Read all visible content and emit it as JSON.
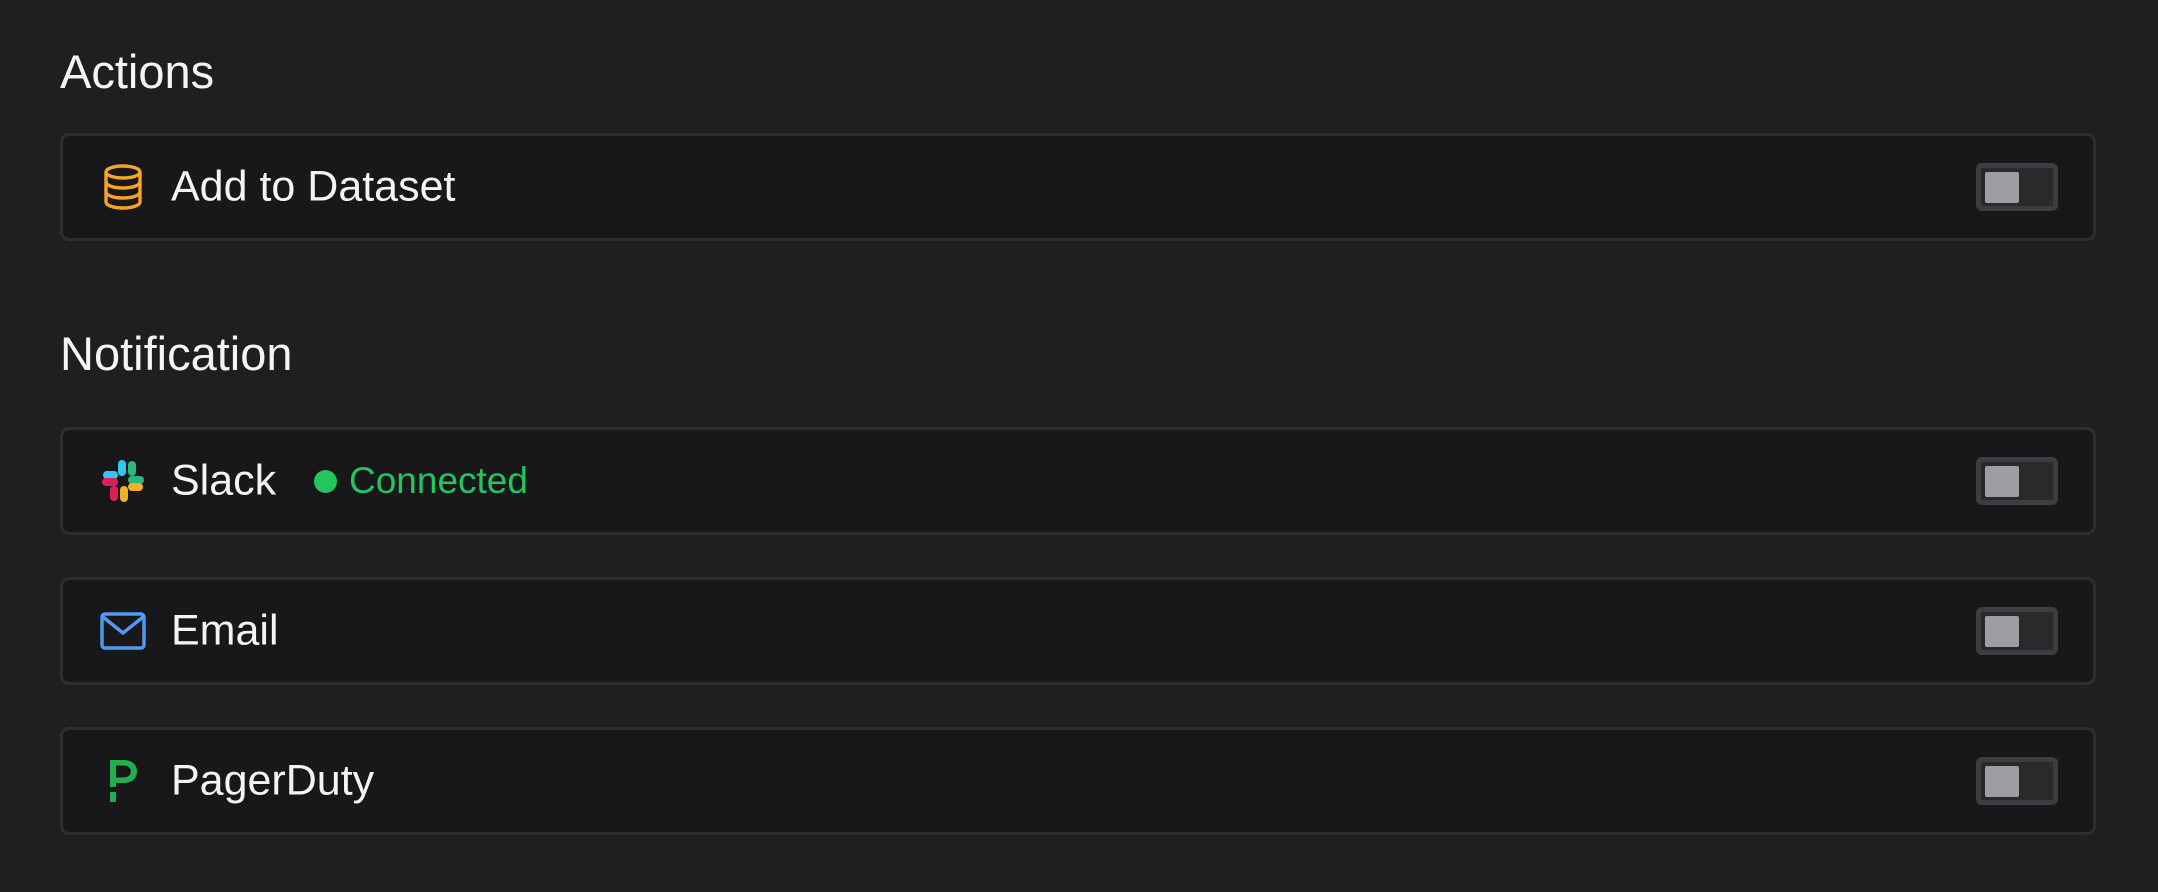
{
  "actions": {
    "title": "Actions",
    "items": [
      {
        "label": "Add to Dataset",
        "icon": "database-icon",
        "icon_color": "#f5a524",
        "enabled": false
      }
    ]
  },
  "notification": {
    "title": "Notification",
    "items": [
      {
        "label": "Slack",
        "icon": "slack-icon",
        "status": "Connected",
        "status_color": "#22c55e",
        "enabled": false
      },
      {
        "label": "Email",
        "icon": "mail-icon",
        "icon_color": "#4f9cf5",
        "enabled": false
      },
      {
        "label": "PagerDuty",
        "icon": "pagerduty-icon",
        "icon_color": "#1fb050",
        "enabled": false
      }
    ]
  }
}
